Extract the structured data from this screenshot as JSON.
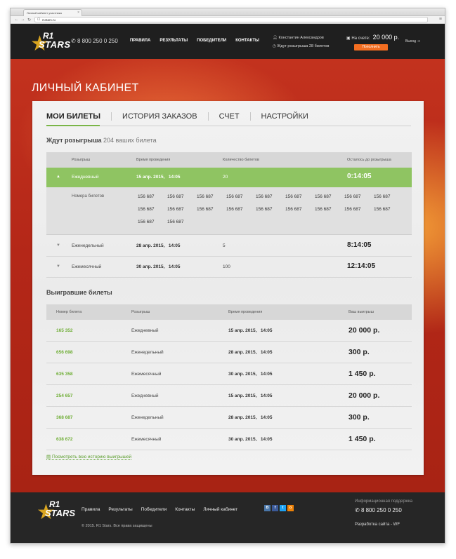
{
  "browser": {
    "tab_title": "Личный кабинет участника",
    "url": "r1stars.ru",
    "close_glyph": "×"
  },
  "header": {
    "logo_r1": "R1",
    "logo_stars": "STARS",
    "phone": "8 800 250 0 250",
    "nav": [
      "ПРАВИЛА",
      "РЕЗУЛЬТАТЫ",
      "ПОБЕДИТЕЛИ",
      "КОНТАКТЫ"
    ],
    "user_name": "Константин Александров",
    "pending_note": "Ждут розыгрыша 28 билетов",
    "balance_label": "На счете:",
    "balance_value": "20 000 р.",
    "topup_label": "Пополнить",
    "logout_label": "Выход"
  },
  "page": {
    "title": "ЛИЧНЫЙ КАБИНЕТ",
    "tabs": [
      "МОИ БИЛЕТЫ",
      "ИСТОРИЯ ЗАКАЗОВ",
      "СЧЕТ",
      "НАСТРОЙКИ"
    ]
  },
  "pending": {
    "title": "Ждут розыгрыша",
    "count_text": "204 ваших билета",
    "columns": [
      "Розыгрыш",
      "Время проведения",
      "Количество билетов",
      "Осталось до розыгрыша"
    ],
    "active_row": {
      "draw": "Ежедневный",
      "date": "15 апр. 2015,",
      "time": "14:05",
      "count": "20",
      "remaining": "0:14:05"
    },
    "numbers_label": "Номера билетов",
    "numbers": [
      "156 687",
      "156 687",
      "156 687",
      "156 687",
      "156 687",
      "156 687",
      "156 687",
      "156 687",
      "156 687",
      "156 687",
      "156 687",
      "156 687",
      "156 687",
      "156 687",
      "156 687",
      "156 687",
      "156 687",
      "156 687",
      "156 687",
      "156 687"
    ],
    "rows": [
      {
        "draw": "Еженедельный",
        "date": "28 апр. 2015,",
        "time": "14:05",
        "count": "5",
        "remaining": "8:14:05"
      },
      {
        "draw": "Ежемесячный",
        "date": "30 апр. 2015,",
        "time": "14:05",
        "count": "100",
        "remaining": "12:14:05"
      }
    ]
  },
  "winning": {
    "title": "Выигравшие билеты",
    "columns": [
      "Номер билета",
      "Розыгрыш",
      "Время проведения",
      "Ваш выигрыш"
    ],
    "rows": [
      {
        "number": "165 352",
        "draw": "Ежедневный",
        "date": "15 апр. 2015,",
        "time": "14:05",
        "prize": "20 000 р."
      },
      {
        "number": "656 698",
        "draw": "Еженедельный",
        "date": "28 апр. 2015,",
        "time": "14:05",
        "prize": "300 р."
      },
      {
        "number": "635 358",
        "draw": "Ежемесячный",
        "date": "30 апр. 2015,",
        "time": "14:05",
        "prize": "1 450 р."
      },
      {
        "number": "254 657",
        "draw": "Ежедневный",
        "date": "15 апр. 2015,",
        "time": "14:05",
        "prize": "20 000 р."
      },
      {
        "number": "368 687",
        "draw": "Еженедельный",
        "date": "28 апр. 2015,",
        "time": "14:05",
        "prize": "300 р."
      },
      {
        "number": "638 672",
        "draw": "Ежемесячный",
        "date": "30 апр. 2015,",
        "time": "14:05",
        "prize": "1 450 р."
      }
    ],
    "history_link": "Посмотреть всю историю выигрышей"
  },
  "footer": {
    "logo_r1": "R1",
    "logo_stars": "STARS",
    "nav": [
      "Правила",
      "Результаты",
      "Победители",
      "Контакты",
      "Личный кабинет"
    ],
    "social": [
      {
        "label": "В",
        "color": "#4a76a8"
      },
      {
        "label": "f",
        "color": "#3b5998"
      },
      {
        "label": "t",
        "color": "#1da1f2"
      },
      {
        "label": "о",
        "color": "#ee8208"
      }
    ],
    "copyright": "© 2015. R1 Stars. Все права защищены",
    "support_label": "Информационная поддержка",
    "support_phone": "8 800 250 0 250",
    "developer": "Разработка сайта - WF"
  },
  "colors": {
    "accent_green": "#8fc462",
    "topup_orange": "#f36e21",
    "hero_red": "#b42718"
  }
}
